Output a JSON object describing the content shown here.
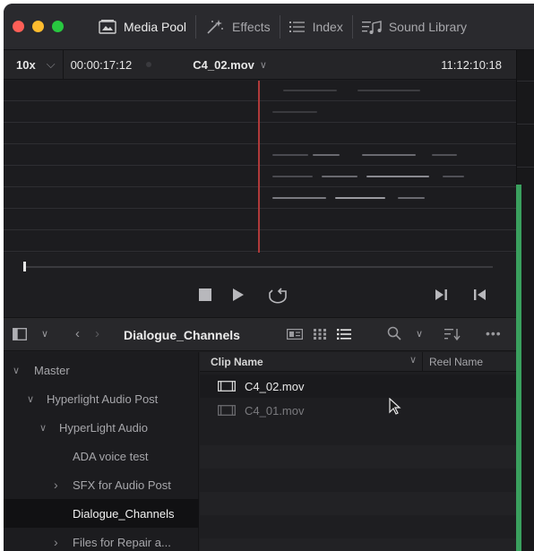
{
  "titlebar": {
    "tabs": [
      {
        "label": "Media Pool",
        "icon": "media-pool-icon"
      },
      {
        "label": "Effects",
        "icon": "effects-wand-icon"
      },
      {
        "label": "Index",
        "icon": "index-list-icon"
      },
      {
        "label": "Sound Library",
        "icon": "sound-library-icon"
      }
    ]
  },
  "viewer": {
    "zoom": "10x",
    "source_timecode": "00:00:17:12",
    "clip_name": "C4_02.mov",
    "record_timecode": "11:12:10:18"
  },
  "pool": {
    "bin_title": "Dialogue_Channels",
    "column_clip_name": "Clip Name",
    "column_reel_name": "Reel Name"
  },
  "tree": {
    "items": [
      {
        "label": "Master",
        "chevron": "v"
      },
      {
        "label": "Hyperlight Audio Post",
        "chevron": "v"
      },
      {
        "label": "HyperLight Audio",
        "chevron": "v"
      },
      {
        "label": "ADA voice test",
        "chevron": ""
      },
      {
        "label": "SFX for Audio Post",
        "chevron": ">"
      },
      {
        "label": "Dialogue_Channels",
        "chevron": ""
      },
      {
        "label": "Files for Repair a...",
        "chevron": ">"
      }
    ]
  },
  "clips": [
    {
      "name": "C4_02.mov"
    },
    {
      "name": "C4_01.mov"
    }
  ],
  "colors": {
    "playhead": "#b03a3a",
    "audio_meter": "#3aa05e",
    "panel_bg": "#1e1e21"
  }
}
